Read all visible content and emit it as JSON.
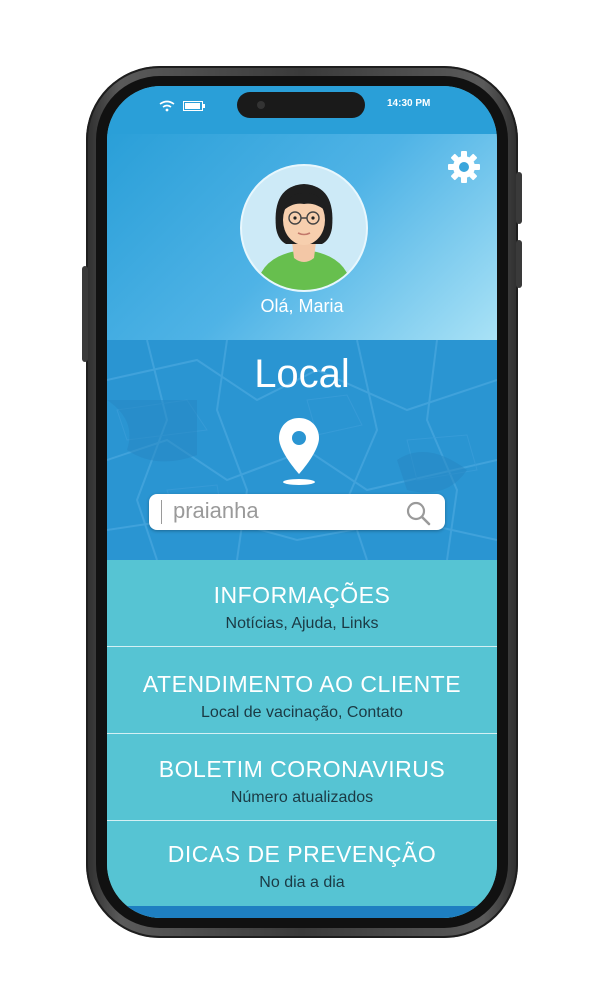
{
  "status_bar": {
    "left_icons": "wifi-icon battery-icon",
    "time": "14:30 PM"
  },
  "profile": {
    "greeting": "Olá, Maria",
    "settings_icon": "gear-icon"
  },
  "local": {
    "title": "Local",
    "search_value": "praianha",
    "pin_icon": "location-pin-icon",
    "search_icon": "search-icon"
  },
  "menu": {
    "items": [
      {
        "title": "INFORMAÇÕES",
        "subtitle": "Notícias, Ajuda, Links"
      },
      {
        "title": "ATENDIMENTO AO CLIENTE",
        "subtitle": "Local de vacinação, Contato"
      },
      {
        "title": "BOLETIM CORONAVIRUS",
        "subtitle": "Número atualizados"
      },
      {
        "title": "DICAS DE PREVENÇÃO",
        "subtitle": "No dia a dia"
      }
    ]
  },
  "colors": {
    "header_blue": "#2a9fd8",
    "map_blue": "#2a95d2",
    "menu_teal": "#56c4d3",
    "bottom_blue": "#1e7fc1"
  }
}
